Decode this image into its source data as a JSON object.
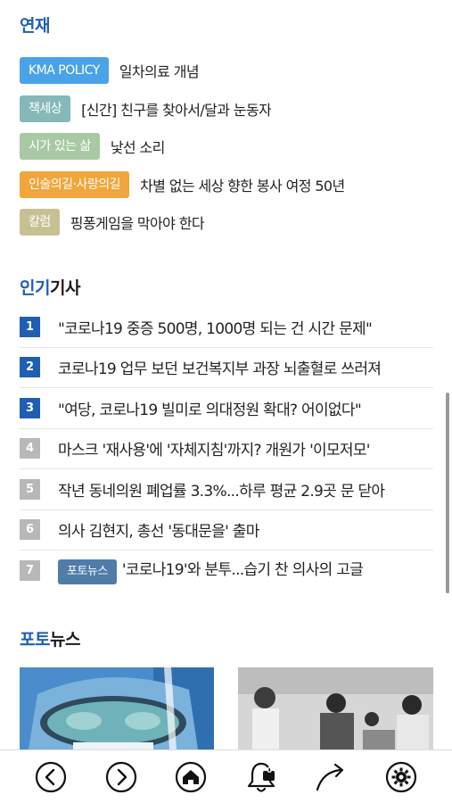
{
  "serial": {
    "title_accent": "연재",
    "items": [
      {
        "tag": "KMA POLICY",
        "tag_color": "#4aa3e8",
        "text": "일차의료 개념"
      },
      {
        "tag": "책세상",
        "tag_color": "#86b8b9",
        "text": "[신간] 친구를 찾아서/달과 눈동자"
      },
      {
        "tag": "시가 있는 삶",
        "tag_color": "#a8c9a4",
        "text": "낯선 소리"
      },
      {
        "tag": "인술의길·사랑의길",
        "tag_color": "#f0a63c",
        "text": "차별 없는 세상 향한 봉사 여정 50년"
      },
      {
        "tag": "칼럼",
        "tag_color": "#c7c092",
        "text": "핑퐁게임을 막아야 한다"
      }
    ]
  },
  "popular": {
    "title_accent": "인기",
    "title_rest": "기사",
    "items": [
      {
        "rank": "1",
        "text": "\"코로나19 중증 500명, 1000명 되는 건 시간 문제\"",
        "badge": ""
      },
      {
        "rank": "2",
        "text": "코로나19 업무 보던 보건복지부 과장 뇌출혈로 쓰러져",
        "badge": ""
      },
      {
        "rank": "3",
        "text": "\"여당, 코로나19 빌미로 의대정원 확대? 어이없다\"",
        "badge": ""
      },
      {
        "rank": "4",
        "text": "마스크 '재사용'에 '자체지침'까지? 개원가 '이모저모'",
        "badge": ""
      },
      {
        "rank": "5",
        "text": "작년 동네의원 폐업률 3.3%...하루 평균 2.9곳 문 닫아",
        "badge": ""
      },
      {
        "rank": "6",
        "text": "의사 김현지, 총선 '동대문을' 출마",
        "badge": ""
      },
      {
        "rank": "7",
        "text": "'코로나19'와 분투...습기 찬 의사의 고글",
        "badge": "포토뉴스"
      }
    ]
  },
  "photo_news": {
    "title_accent": "포토",
    "title_rest": "뉴스"
  },
  "bottom_nav": [
    {
      "name": "back-button",
      "icon": "chevron-left-icon"
    },
    {
      "name": "forward-button",
      "icon": "chevron-right-icon"
    },
    {
      "name": "home-button",
      "icon": "home-icon"
    },
    {
      "name": "notifications-button",
      "icon": "bell-icon",
      "badge": "0"
    },
    {
      "name": "share-button",
      "icon": "share-arrow-icon"
    },
    {
      "name": "settings-button",
      "icon": "gear-icon"
    }
  ],
  "colors": {
    "accent": "#1f5fb3",
    "rank_inactive": "#b8b8b8",
    "photo_badge": "#4f7ca8"
  }
}
